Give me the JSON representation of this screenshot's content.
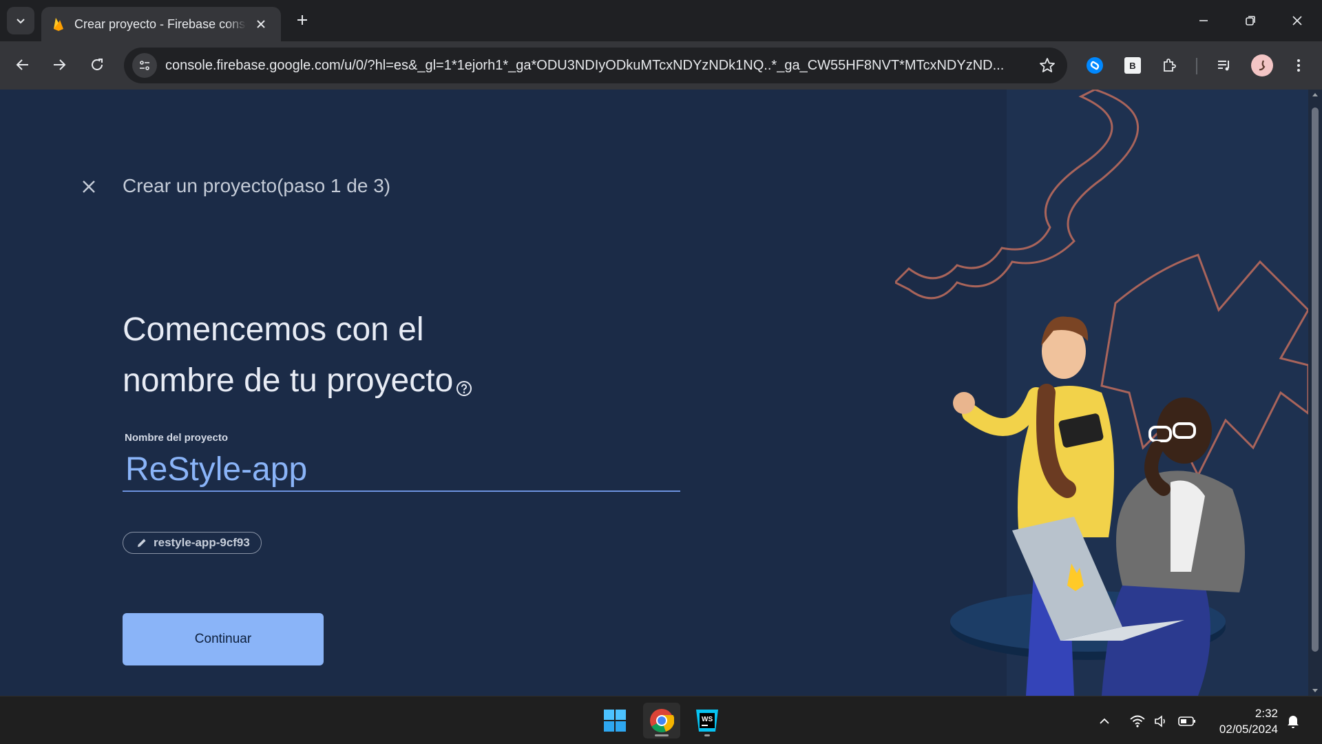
{
  "browser": {
    "tab_title": "Crear proyecto - Firebase console",
    "url": "console.firebase.google.com/u/0/?hl=es&_gl=1*1ejorh1*_ga*ODU3NDIyODkuMTcxNDYzNDk1NQ..*_ga_CW55HF8NVT*MTcxNDYzND...",
    "extensions": [
      "shazam-icon",
      "b-extension-icon",
      "puzzle-icon"
    ],
    "extension_b_label": "B"
  },
  "page": {
    "header_title": "Crear un proyecto(paso 1 de 3)",
    "headline_line1": "Comencemos con el",
    "headline_line2": "nombre de tu proyecto",
    "field_label": "Nombre del proyecto",
    "field_value": "ReStyle-app",
    "project_id": "restyle-app-9cf93",
    "continue_label": "Continuar"
  },
  "taskbar": {
    "time": "2:32",
    "date": "02/05/2024"
  },
  "colors": {
    "page_bg": "#1b2b47",
    "accent": "#8ab4f8",
    "firebase_orange": "#ffa000"
  }
}
